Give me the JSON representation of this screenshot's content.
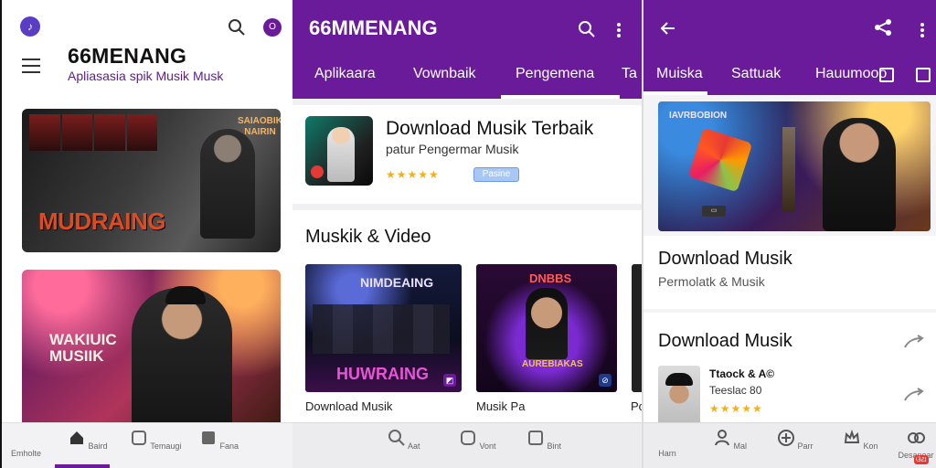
{
  "screen1": {
    "app_name": "66MENANG",
    "subtitle": "Apliasasia spik Musik Musk",
    "card1_big": "MUDRAING",
    "card1_small": "SAIAOBIK\nNAIRIN",
    "card2_text": "WAKIUIC\nMUSIIK",
    "nav": [
      "Emholte",
      "Baird",
      "Temaugi",
      "Fana"
    ]
  },
  "screen2": {
    "app_name": "66MMENANG",
    "tabs": [
      "Aplikaara",
      "Vownbaik",
      "Pengemena",
      "Ta"
    ],
    "featured_title": "Download Musik Terbaik",
    "featured_subtitle": "patur Pengermar Musik",
    "featured_stars": "★★★★★",
    "featured_pill": "Pasine",
    "section_title": "Muskik & Video",
    "thumb1_top": "NIMDEAING",
    "thumb1_bottom": "HUWRAING",
    "thumb2_top": "DNBBS",
    "thumb2_bottom": "AUREBIAKAS",
    "cap1": "Download Musik",
    "cap2": "Musik Pa",
    "cap3": "Pc",
    "nav": [
      "Aat",
      "Vont",
      "Bint"
    ]
  },
  "screen3": {
    "tabs": [
      "Muiska",
      "Sattuak",
      "Hauumooo"
    ],
    "hero_label": "IAVRBOBION",
    "card1_title": "Download Musik",
    "card1_subtitle": "Permolatk & Musik",
    "card2_title": "Download Musik",
    "mini_title": "Ttaock & A©",
    "mini_sub": "Teeslac 80",
    "mini_stars": "★★★★★",
    "nav": [
      "Harn",
      "Mal",
      "Parr",
      "Kon",
      "Desanear"
    ],
    "badge": "ଓଥ"
  }
}
